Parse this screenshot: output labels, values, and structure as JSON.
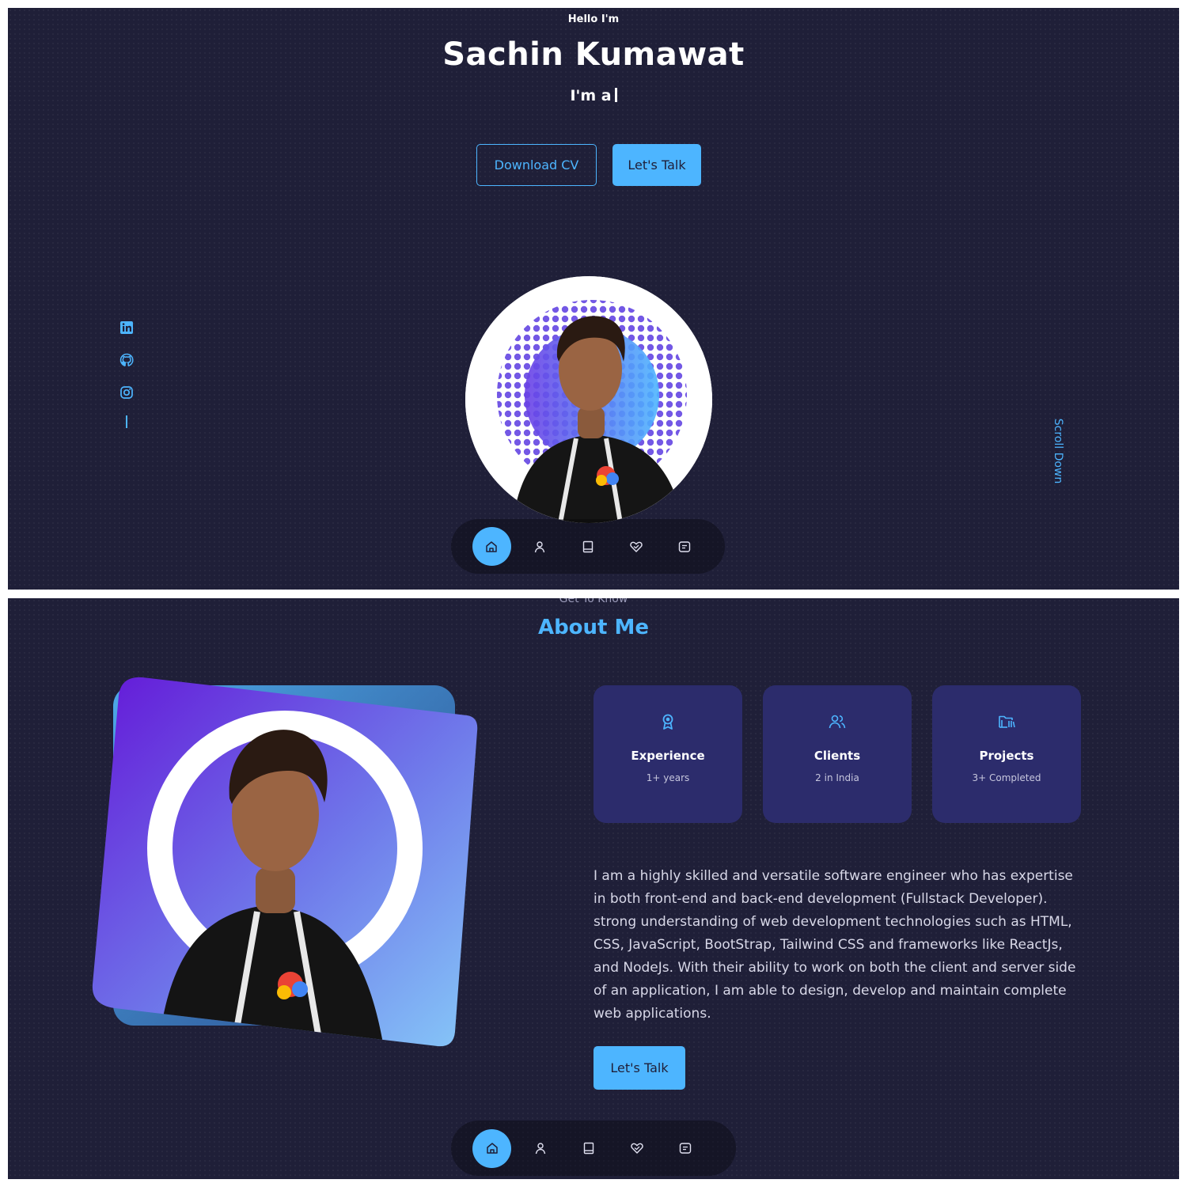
{
  "hero": {
    "greeting": "Hello I'm",
    "name": "Sachin Kumawat",
    "typing_text": "I'm a",
    "buttons": {
      "download_cv": "Download CV",
      "lets_talk": "Let's Talk"
    },
    "socials": [
      "linkedin-icon",
      "github-icon",
      "instagram-icon"
    ],
    "scroll_down": "Scroll Down"
  },
  "about": {
    "subtitle": "Get To Know",
    "title": "About Me",
    "cards": [
      {
        "icon": "award-icon",
        "title": "Experience",
        "sub": "1+ years"
      },
      {
        "icon": "users-icon",
        "title": "Clients",
        "sub": "2 in India"
      },
      {
        "icon": "folder-icon",
        "title": "Projects",
        "sub": "3+ Completed"
      }
    ],
    "description": "I am a highly skilled and versatile software engineer who has expertise in both front-end and back-end development (Fullstack Developer). strong understanding of web development technologies such as HTML, CSS, JavaScript, BootStrap, Tailwind CSS and frameworks like ReactJs, and NodeJs. With their ability to work on both the client and server side of an application, I am able to design, develop and maintain complete web applications.",
    "cta": "Let's Talk"
  },
  "nav": {
    "items": [
      "home-icon",
      "user-icon",
      "book-icon",
      "services-icon",
      "message-icon"
    ],
    "active": "home-icon"
  },
  "colors": {
    "background": "#1f1f38",
    "primary": "#4db5ff",
    "card": "#2c2c6c",
    "gradient_start": "#6d28d9",
    "gradient_end": "#7cc0f5"
  }
}
